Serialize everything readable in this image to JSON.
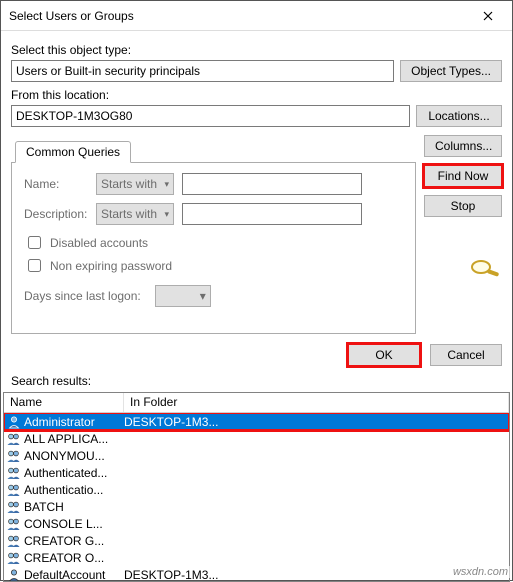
{
  "window": {
    "title": "Select Users or Groups"
  },
  "objectType": {
    "label": "Select this object type:",
    "value": "Users or Built-in security principals",
    "button": "Object Types..."
  },
  "location": {
    "label": "From this location:",
    "value": "DESKTOP-1M3OG80",
    "button": "Locations..."
  },
  "common": {
    "tab": "Common Queries",
    "nameLabel": "Name:",
    "nameMode": "Starts with",
    "descLabel": "Description:",
    "descMode": "Starts with",
    "disabled": "Disabled accounts",
    "nonexp": "Non expiring password",
    "logonLabel": "Days since last logon:"
  },
  "side": {
    "columns": "Columns...",
    "find": "Find Now",
    "stop": "Stop"
  },
  "actions": {
    "ok": "OK",
    "cancel": "Cancel"
  },
  "resultsLabel": "Search results:",
  "headers": {
    "name": "Name",
    "folder": "In Folder"
  },
  "rows": [
    {
      "name": "Administrator",
      "folder": "DESKTOP-1M3...",
      "selected": true,
      "kind": "user"
    },
    {
      "name": "ALL APPLICA...",
      "folder": "",
      "selected": false,
      "kind": "group"
    },
    {
      "name": "ANONYMOU...",
      "folder": "",
      "selected": false,
      "kind": "group"
    },
    {
      "name": "Authenticated...",
      "folder": "",
      "selected": false,
      "kind": "group"
    },
    {
      "name": "Authenticatio...",
      "folder": "",
      "selected": false,
      "kind": "group"
    },
    {
      "name": "BATCH",
      "folder": "",
      "selected": false,
      "kind": "group"
    },
    {
      "name": "CONSOLE L...",
      "folder": "",
      "selected": false,
      "kind": "group"
    },
    {
      "name": "CREATOR G...",
      "folder": "",
      "selected": false,
      "kind": "group"
    },
    {
      "name": "CREATOR O...",
      "folder": "",
      "selected": false,
      "kind": "group"
    },
    {
      "name": "DefaultAccount",
      "folder": "DESKTOP-1M3...",
      "selected": false,
      "kind": "user"
    }
  ],
  "watermark": "wsxdn.com"
}
